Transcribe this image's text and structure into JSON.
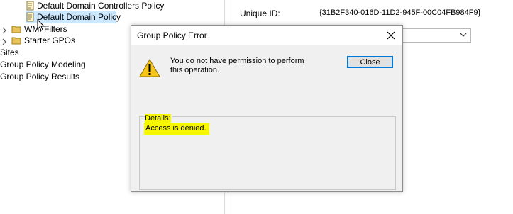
{
  "tree": {
    "items": [
      {
        "label": "Default Domain Controllers Policy"
      },
      {
        "label": "Default Domain Policy"
      },
      {
        "label": "WMI Filters"
      },
      {
        "label": "Starter GPOs"
      },
      {
        "label": "Sites"
      },
      {
        "label": "Group Policy Modeling"
      },
      {
        "label": "Group Policy Results"
      }
    ]
  },
  "details_pane": {
    "unique_id_label": "Unique ID:",
    "unique_id_value": "{31B2F340-016D-11D2-945F-00C04FB984F9}"
  },
  "dialog": {
    "title": "Group Policy Error",
    "message": "You do not have permission to perform this operation.",
    "close_button": "Close",
    "details_label": "Details:",
    "details_text": "Access is denied."
  },
  "colors": {
    "selection": "#cce8ff",
    "highlight": "#f7f700",
    "button_focus": "#0078d7"
  }
}
